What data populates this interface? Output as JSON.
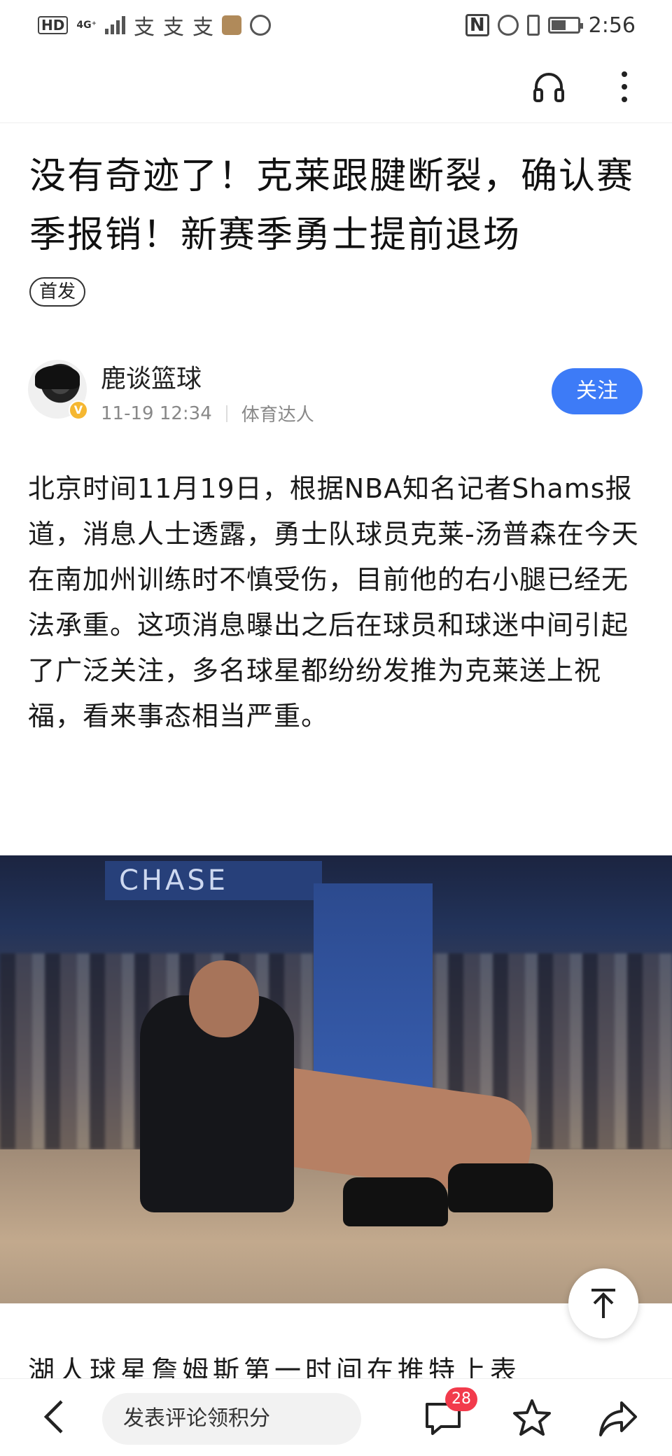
{
  "status_bar": {
    "left_badge": "HD",
    "network": "4G⁺",
    "app_glyphs": [
      "支",
      "支",
      "支"
    ],
    "time": "2:56",
    "nfc": "N"
  },
  "article": {
    "title": "没有奇迹了！克莱跟腱断裂，确认赛季报销！新赛季勇士提前退场",
    "tag": "首发",
    "author": {
      "name": "鹿谈篮球",
      "verified_mark": "V",
      "date": "11-19 12:34",
      "category": "体育达人",
      "follow_label": "关注"
    },
    "paragraph_1": "北京时间11月19日，根据NBA知名记者Shams报道，消息人士透露，勇士队球员克莱-汤普森在今天在南加州训练时不慎受伤，目前他的右小腿已经无法承重。这项消息曝出之后在球员和球迷中间引起了广泛关注，多名球星都纷纷发推为克莱送上祝福，看来事态相当严重。",
    "photo": {
      "banner_text": "CHASE"
    },
    "paragraph_2": "湖人球星詹姆斯第一时间在推特上表"
  },
  "bottom_bar": {
    "comment_placeholder": "发表评论领积分",
    "comment_count": "28"
  },
  "colors": {
    "accent": "#3d7bf7",
    "badge": "#f23b4c",
    "verified": "#f5b731"
  },
  "icons": [
    "headphone-icon",
    "more-icon",
    "back-icon",
    "comment-icon",
    "star-icon",
    "share-icon",
    "arrow-up-icon"
  ]
}
